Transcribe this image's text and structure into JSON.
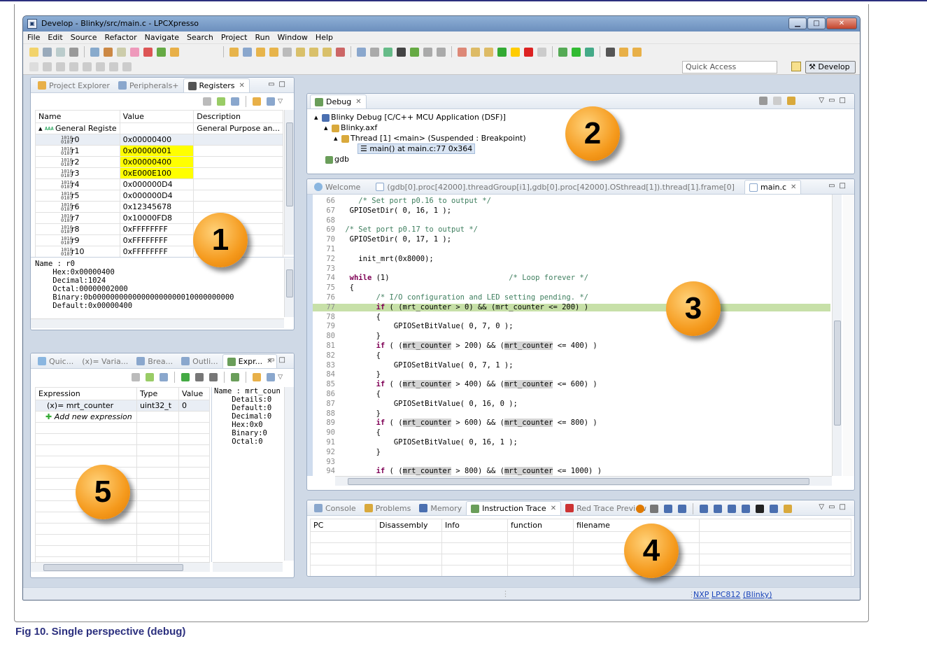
{
  "window": {
    "title": "Develop - Blinky/src/main.c - LPCXpresso"
  },
  "menubar": [
    "File",
    "Edit",
    "Source",
    "Refactor",
    "Navigate",
    "Search",
    "Project",
    "Run",
    "Window",
    "Help"
  ],
  "toolbar": {
    "quick_access": "Quick Access",
    "perspective": "Develop"
  },
  "panel1": {
    "tabs": [
      "Project Explorer",
      "Peripherals+",
      "Registers"
    ],
    "columns": [
      "Name",
      "Value",
      "Description"
    ],
    "group": {
      "name": "General Registe",
      "description": "General Purpose an..."
    },
    "rows": [
      {
        "name": "r0",
        "value": "0x00000400",
        "hl": false
      },
      {
        "name": "r1",
        "value": "0x00000001",
        "hl": true
      },
      {
        "name": "r2",
        "value": "0x00000400",
        "hl": true
      },
      {
        "name": "r3",
        "value": "0xE000E100",
        "hl": true
      },
      {
        "name": "r4",
        "value": "0x000000D4",
        "hl": false
      },
      {
        "name": "r5",
        "value": "0x000000D4",
        "hl": false
      },
      {
        "name": "r6",
        "value": "0x12345678",
        "hl": false
      },
      {
        "name": "r7",
        "value": "0x10000FD8",
        "hl": false
      },
      {
        "name": "r8",
        "value": "0xFFFFFFFF",
        "hl": false
      },
      {
        "name": "r9",
        "value": "0xFFFFFFFF",
        "hl": false
      },
      {
        "name": "r10",
        "value": "0xFFFFFFFF",
        "hl": false
      }
    ],
    "detail": [
      "Name : r0",
      "    Hex:0x00000400",
      "    Decimal:1024",
      "    Octal:00000002000",
      "    Binary:0b00000000000000000000010000000000",
      "    Default:0x00000400"
    ]
  },
  "panel2": {
    "tab": "Debug",
    "tree": [
      "Blinky Debug [C/C++ MCU Application (DSF)]",
      "Blinky.axf",
      "Thread [1] <main> (Suspended : Breakpoint)",
      "main() at main.c:77 0x364",
      "gdb"
    ]
  },
  "panel3": {
    "tabs": [
      "Welcome",
      "(gdb[0].proc[42000].threadGroup[i1],gdb[0].proc[42000].OSthread[1]).thread[1].frame[0]",
      "main.c"
    ],
    "lines": [
      {
        "n": "66",
        "t": "    /* Set port p0.16 to output */",
        "cls": "cm"
      },
      {
        "n": "67",
        "t": "  GPIOSetDir( 0, 16, 1 );",
        "cls": ""
      },
      {
        "n": "68",
        "t": "",
        "cls": ""
      },
      {
        "n": "69",
        "t": " /* Set port p0.17 to output */",
        "cls": "cm"
      },
      {
        "n": "70",
        "t": "  GPIOSetDir( 0, 17, 1 );",
        "cls": ""
      },
      {
        "n": "71",
        "t": "",
        "cls": ""
      },
      {
        "n": "72",
        "t": "    init_mrt(0x8000);",
        "cls": ""
      },
      {
        "n": "73",
        "t": "",
        "cls": ""
      },
      {
        "n": "74",
        "t": "  while (1)                           /* Loop forever */",
        "cls": "while"
      },
      {
        "n": "75",
        "t": "  {",
        "cls": ""
      },
      {
        "n": "76",
        "t": "        /* I/O configuration and LED setting pending. */",
        "cls": "cm"
      },
      {
        "n": "77",
        "t": "        if ( (mrt_counter > 0) && (mrt_counter <= 200) )",
        "cls": "cur"
      },
      {
        "n": "78",
        "t": "        {",
        "cls": ""
      },
      {
        "n": "79",
        "t": "            GPIOSetBitValue( 0, 7, 0 );",
        "cls": ""
      },
      {
        "n": "80",
        "t": "        }",
        "cls": ""
      },
      {
        "n": "81",
        "t": "        if ( (mrt_counter > 200) && (mrt_counter <= 400) )",
        "cls": "if"
      },
      {
        "n": "82",
        "t": "        {",
        "cls": ""
      },
      {
        "n": "83",
        "t": "            GPIOSetBitValue( 0, 7, 1 );",
        "cls": ""
      },
      {
        "n": "84",
        "t": "        }",
        "cls": ""
      },
      {
        "n": "85",
        "t": "        if ( (mrt_counter > 400) && (mrt_counter <= 600) )",
        "cls": "if"
      },
      {
        "n": "86",
        "t": "        {",
        "cls": ""
      },
      {
        "n": "87",
        "t": "            GPIOSetBitValue( 0, 16, 0 );",
        "cls": ""
      },
      {
        "n": "88",
        "t": "        }",
        "cls": ""
      },
      {
        "n": "89",
        "t": "        if ( (mrt_counter > 600) && (mrt_counter <= 800) )",
        "cls": "if"
      },
      {
        "n": "90",
        "t": "        {",
        "cls": ""
      },
      {
        "n": "91",
        "t": "            GPIOSetBitValue( 0, 16, 1 );",
        "cls": ""
      },
      {
        "n": "92",
        "t": "        }",
        "cls": ""
      },
      {
        "n": "93",
        "t": "",
        "cls": ""
      },
      {
        "n": "94",
        "t": "        if ( (mrt_counter > 800) && (mrt_counter <= 1000) )",
        "cls": "if"
      }
    ]
  },
  "panel4": {
    "tabs": [
      "Console",
      "Problems",
      "Memory",
      "Instruction Trace",
      "Red Trace Preview"
    ],
    "columns": [
      "PC",
      "Disassembly",
      "Info",
      "function",
      "filename"
    ]
  },
  "panel5": {
    "tabs": [
      "Quic...",
      "(x)= Varia...",
      "Brea...",
      "Outli...",
      "Expr..."
    ],
    "columns": [
      "Expression",
      "Type",
      "Value"
    ],
    "rows": [
      {
        "expr": "(x)= mrt_counter",
        "type": "uint32_t",
        "value": "0"
      }
    ],
    "add": "Add new expression",
    "detail": [
      "Name : mrt_coun",
      "    Details:0",
      "    Default:0",
      "    Decimal:0",
      "    Hex:0x0",
      "    Binary:0",
      "    Octal:0"
    ]
  },
  "status": {
    "nxp": "NXP",
    "chip": "LPC812",
    "project": "(Blinky)"
  },
  "badges": [
    "1",
    "2",
    "3",
    "4",
    "5"
  ],
  "caption": "Fig 10.   Single perspective (debug)",
  "colors": {
    "highlight": "#ffff00",
    "current_line": "#c7e0a8",
    "badge": "#f59a1d",
    "caption": "#2b2f7e"
  }
}
